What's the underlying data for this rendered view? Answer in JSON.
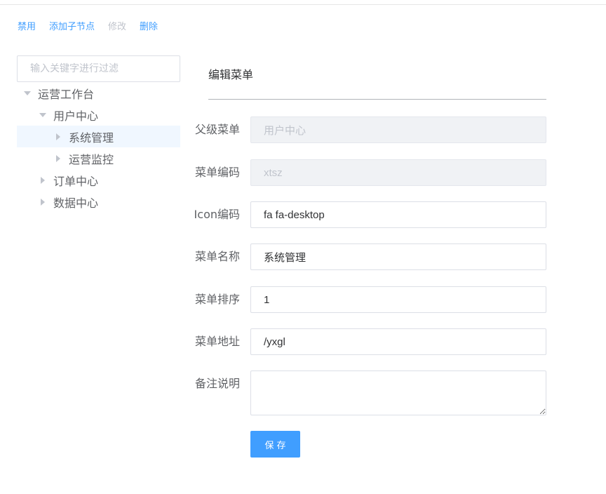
{
  "toolbar": {
    "disable_label": "禁用",
    "add_child_label": "添加子节点",
    "edit_label": "修改",
    "delete_label": "删除"
  },
  "tree": {
    "filter_placeholder": "输入关键字进行过滤",
    "nodes": [
      {
        "label": "运营工作台",
        "level": 0,
        "expanded": true
      },
      {
        "label": "用户中心",
        "level": 1,
        "expanded": true
      },
      {
        "label": "系统管理",
        "level": 2,
        "expanded": false,
        "current": true
      },
      {
        "label": "运营监控",
        "level": 2,
        "expanded": false
      },
      {
        "label": "订单中心",
        "level": 1,
        "expanded": false
      },
      {
        "label": "数据中心",
        "level": 1,
        "expanded": false
      }
    ]
  },
  "form": {
    "title": "编辑菜单",
    "parent": {
      "label": "父级菜单",
      "value": "用户中心"
    },
    "code": {
      "label": "菜单编码",
      "value": "xtsz"
    },
    "icon": {
      "label": "Icon编码",
      "value": "fa fa-desktop"
    },
    "name": {
      "label": "菜单名称",
      "value": "系统管理"
    },
    "order": {
      "label": "菜单排序",
      "value": "1"
    },
    "url": {
      "label": "菜单地址",
      "value": "/yxgl"
    },
    "remark": {
      "label": "备注说明",
      "value": ""
    },
    "save_label": "保存"
  },
  "colors": {
    "accent": "#409eff",
    "disabled_text": "#c0c4cc",
    "current_node_bg": "#f0f7ff"
  }
}
